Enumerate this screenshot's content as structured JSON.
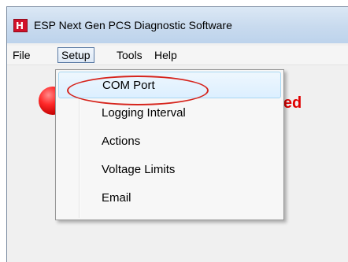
{
  "window": {
    "title": "ESP Next Gen PCS Diagnostic Software",
    "icon": "app-logo-icon",
    "icon_glyph": "H"
  },
  "menu_bar": {
    "items": [
      {
        "label": "File",
        "active": false
      },
      {
        "label": "Setup",
        "active": true
      },
      {
        "label": "Tools",
        "active": false
      },
      {
        "label": "Help",
        "active": false
      }
    ]
  },
  "setup_menu": {
    "items": [
      {
        "label": "COM Port",
        "highlighted": true
      },
      {
        "label": "Logging Interval",
        "highlighted": false
      },
      {
        "label": "Actions",
        "highlighted": false
      },
      {
        "label": "Voltage Limits",
        "highlighted": false
      },
      {
        "label": "Email",
        "highlighted": false
      }
    ]
  },
  "status": {
    "text": "ected",
    "indicator": "status-led-icon",
    "color": "#e00000"
  },
  "annotation": {
    "color": "#d6241c"
  }
}
